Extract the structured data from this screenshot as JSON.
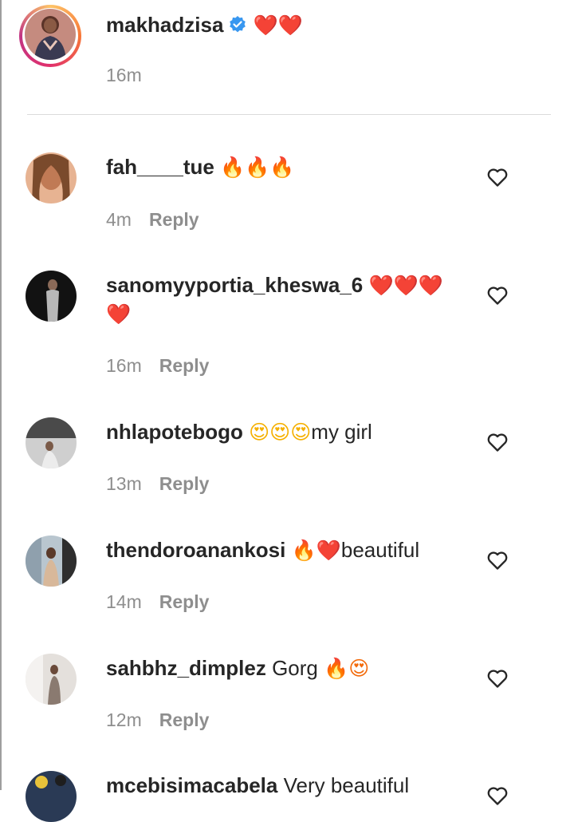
{
  "caption": {
    "username": "makhadzisa",
    "emoji": "❤️❤️",
    "time": "16m"
  },
  "comments": [
    {
      "username": "fah____tue",
      "text": "",
      "emoji": "🔥🔥🔥",
      "time": "4m",
      "reply": "Reply"
    },
    {
      "username": "sanomyyportia_kheswa_6",
      "text": "",
      "emoji": "❤️❤️❤️",
      "emoji_line2": "❤️",
      "time": "16m",
      "reply": "Reply"
    },
    {
      "username": "nhlapotebogo",
      "text": "my girl",
      "emoji": "😍😍😍",
      "time": "13m",
      "reply": "Reply"
    },
    {
      "username": "thendoroanankosi",
      "text": "beautiful",
      "emoji": "🔥❤️",
      "time": "14m",
      "reply": "Reply"
    },
    {
      "username": "sahbhz_dimplez",
      "text": "Gorg",
      "emoji": "🔥😍",
      "time": "12m",
      "reply": "Reply"
    },
    {
      "username": "mcebisimacabela",
      "text": "Very beautiful",
      "emoji": "",
      "time": "",
      "reply": ""
    }
  ],
  "icons": {
    "like": "heart-outline-icon",
    "verified": "verified-badge-icon"
  },
  "colors": {
    "text": "#262626",
    "muted": "#8e8e8e",
    "divider": "#dbdbdb",
    "verified": "#3897f0",
    "heart": "#e0242c"
  }
}
